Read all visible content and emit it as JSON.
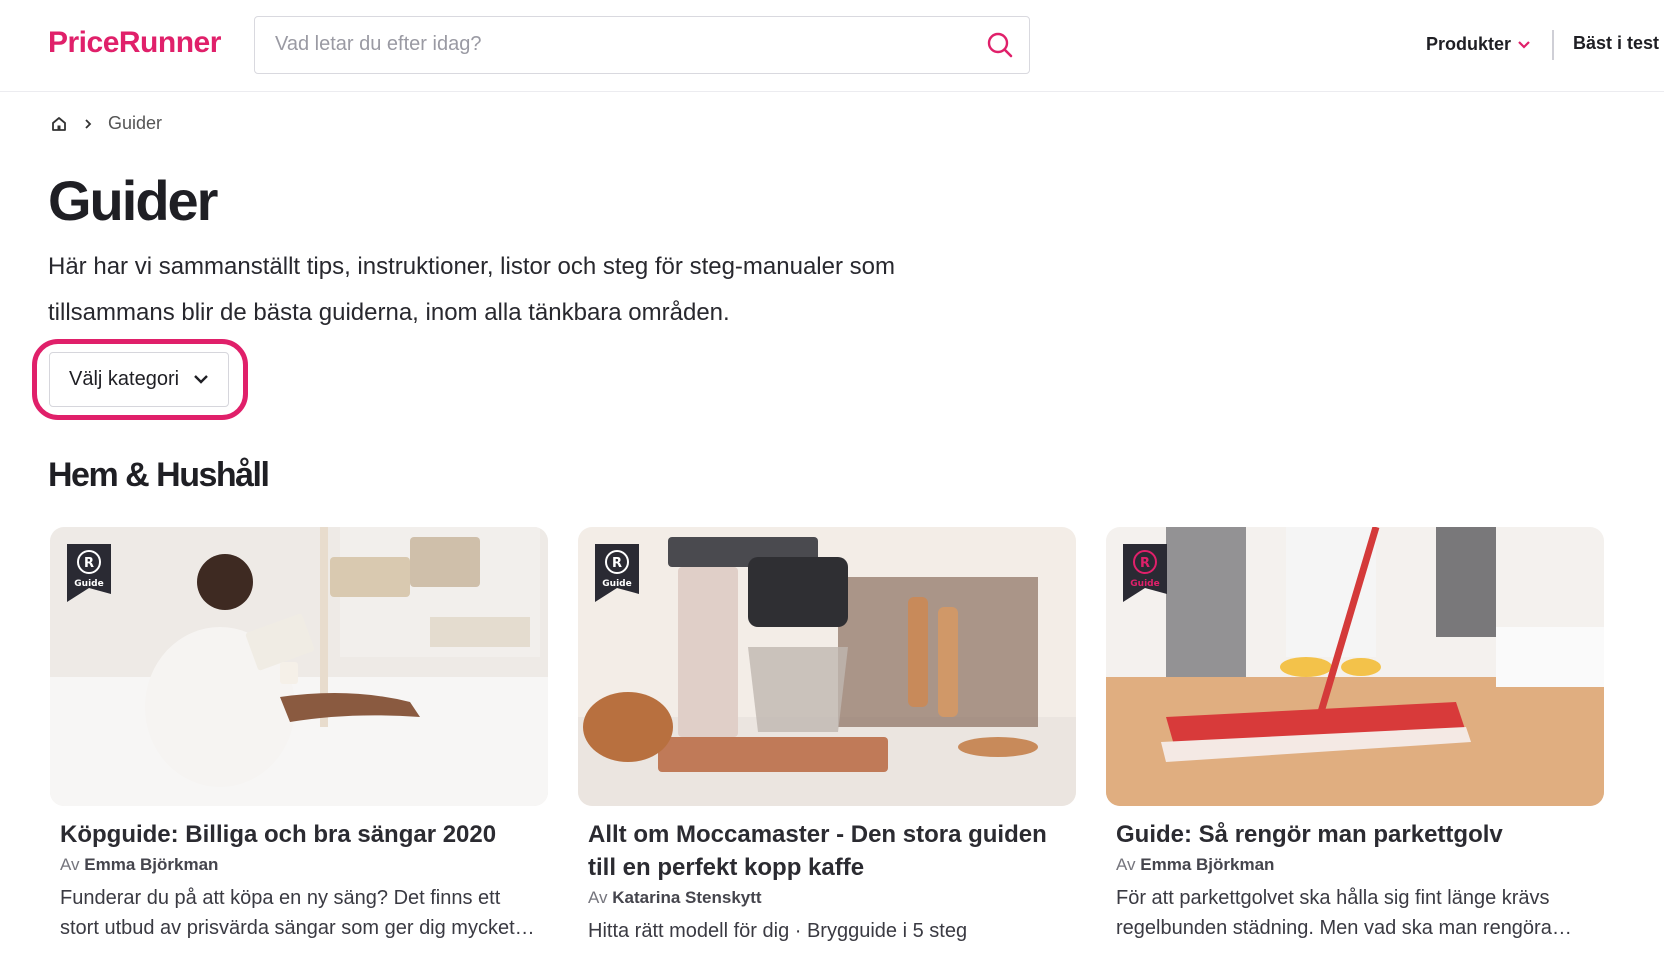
{
  "header": {
    "logo": "PriceRunner",
    "search_placeholder": "Vad letar du efter idag?",
    "nav_products": "Produkter",
    "nav_best": "Bäst i test"
  },
  "breadcrumb": {
    "current": "Guider"
  },
  "page": {
    "title": "Guider",
    "intro": "Här har vi sammanställt tips, instruktioner, listor och steg för steg-manualer som tillsammans blir de bästa guiderna, inom alla tänkbara områden.",
    "category_select": "Välj kategori"
  },
  "section": {
    "title": "Hem & Hushåll",
    "cards": [
      {
        "title": "Köpguide: Billiga och bra sängar 2020",
        "author_prefix": "Av",
        "author": "Emma Björkman",
        "description": "Funderar du på att köpa en ny säng? Det finns ett stort utbud av prisvärda sängar som ger dig mycket för …",
        "badge": "Guide"
      },
      {
        "title": "Allt om Moccamaster  - Den stora guiden till en perfekt kopp kaffe",
        "author_prefix": "Av",
        "author": "Katarina Stenskytt",
        "description": "Hitta rätt modell för dig · Brygguide i 5 steg",
        "badge": "Guide"
      },
      {
        "title": "Guide: Så rengör man parkettgolv",
        "author_prefix": "Av",
        "author": "Emma Björkman",
        "description": "För att parkettgolvet ska hålla sig fint länge krävs regelbunden städning. Men vad ska man rengöra olik…",
        "badge": "Guide"
      }
    ]
  },
  "colors": {
    "brand": "#e0206a",
    "text": "#1f1f24"
  }
}
